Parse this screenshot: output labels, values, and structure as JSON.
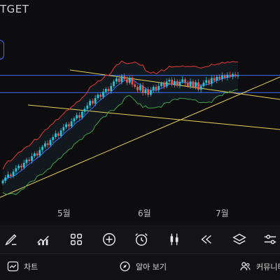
{
  "header": {
    "ticker": "TGET"
  },
  "axis": {
    "months": [
      "5월",
      "6월",
      "7월"
    ]
  },
  "chart_data": {
    "type": "candlestick",
    "overlays": [
      "bollinger-bands",
      "trend-lines",
      "horizontal-channel"
    ],
    "colors": {
      "up": "#26c6da",
      "down": "#ef5350",
      "upper_band": "#e53935",
      "lower_band": "#43a047",
      "mid_band": "#3f6cf5",
      "trend_line": "#e8d35a",
      "channel": "#3f6cf5"
    },
    "close": [
      12,
      12.8,
      13.5,
      13.1,
      14.2,
      15.0,
      15.6,
      15.2,
      16.3,
      17.1,
      16.8,
      17.9,
      18.6,
      18.1,
      19.4,
      20.2,
      21.0,
      20.6,
      21.8,
      22.5,
      23.4,
      22.8,
      24.1,
      24.9,
      25.6,
      25.1,
      26.3,
      27.0,
      27.8,
      27.2,
      28.6,
      29.3,
      30.1,
      31.2,
      30.6,
      31.9,
      32.7,
      32.2,
      33.4,
      34.1,
      33.6,
      34.8,
      35.9,
      36.6,
      35.8,
      37.2,
      36.4,
      35.6,
      36.8,
      35.2,
      34.6,
      33.8,
      34.9,
      33.1,
      34.0,
      32.7,
      33.8,
      34.6,
      33.9,
      34.8,
      35.4,
      34.7,
      35.9,
      36.3,
      35.1,
      36.0,
      34.9,
      35.8,
      36.4,
      35.5,
      34.8,
      35.9,
      34.6,
      35.7,
      33.9,
      34.8,
      35.6,
      36.2,
      35.4,
      36.7,
      36.1,
      37.0,
      36.5,
      37.3,
      36.8,
      37.5,
      37.1,
      37.6,
      37.2,
      37.4
    ],
    "months": [
      "5월",
      "6월",
      "7월"
    ]
  },
  "toolbar": {
    "tools": [
      "draw-tool",
      "indicators",
      "layouts",
      "add",
      "alert",
      "chart-type",
      "replay",
      "layers",
      "settings"
    ]
  },
  "bottom_nav": {
    "chart_label": "차트",
    "ideas_label": "알아 보기",
    "community_label": "커뮤니티"
  }
}
